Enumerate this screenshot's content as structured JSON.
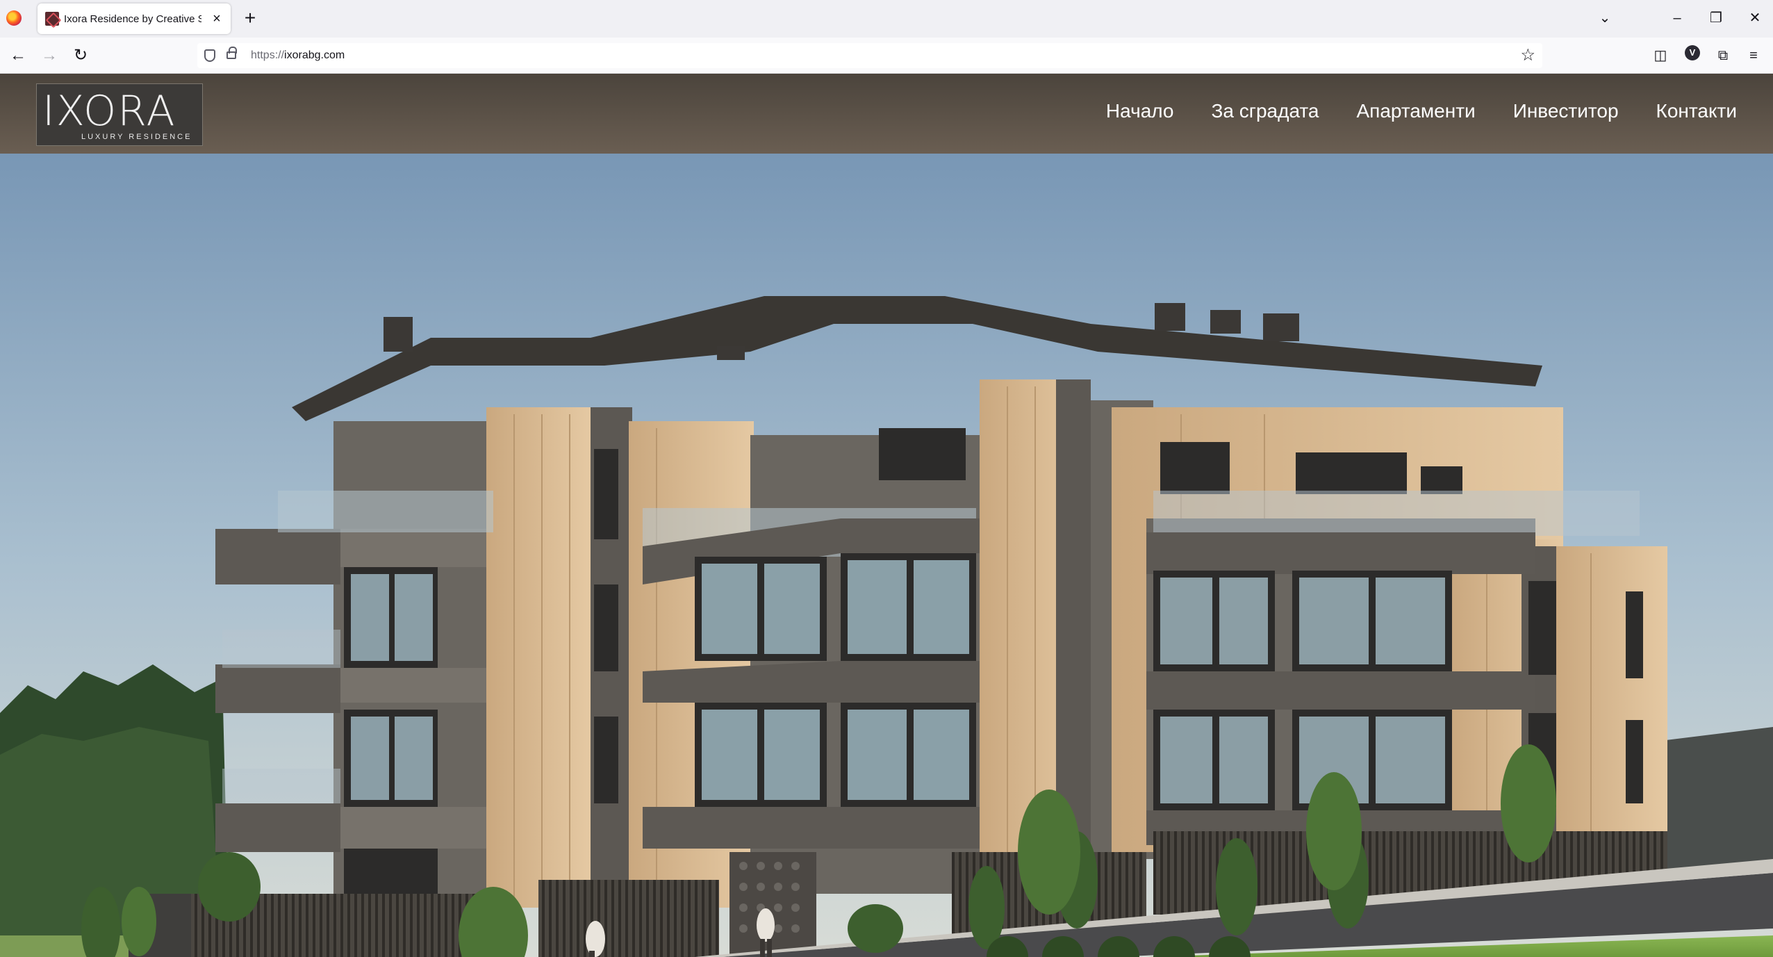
{
  "browser": {
    "tab_title": "Ixora Residence by Creative Stu",
    "tab_close": "×",
    "new_tab": "+",
    "url_scheme": "https://",
    "url_host": "ixorabg.com",
    "list_all_tabs": "⌄",
    "minimize": "–",
    "restore": "❐",
    "close": "✕",
    "back": "←",
    "forward": "→",
    "reload": "↻",
    "bookmark_star": "☆",
    "pocket": "◫",
    "profile_initial": "V",
    "extensions": "⧉",
    "menu": "≡"
  },
  "site": {
    "logo_word": "IXORA",
    "logo_sub": "LUXURY RESIDENCE",
    "nav": [
      {
        "label": "Начало"
      },
      {
        "label": "За сградата"
      },
      {
        "label": "Апартаменти"
      },
      {
        "label": "Инвеститор"
      },
      {
        "label": "Контакти"
      }
    ]
  },
  "colors": {
    "header": "#5a5148",
    "sky": "#7f9cb8",
    "facade_wood": "#d7b892",
    "facade_grey": "#6a6660"
  }
}
